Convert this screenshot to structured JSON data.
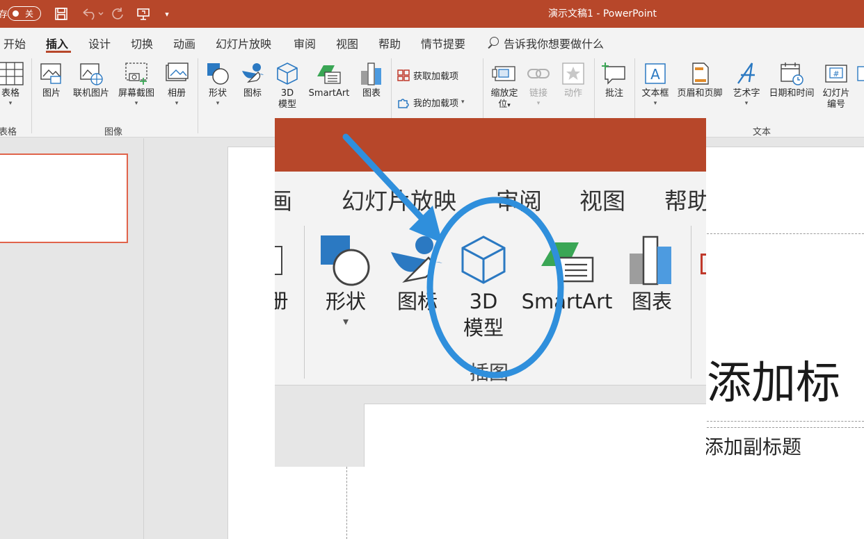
{
  "window": {
    "title": "演示文稿1 - PowerPoint",
    "autosave_partial": "存",
    "autosave_state": "关"
  },
  "tabs": [
    {
      "label": "开始",
      "active": false
    },
    {
      "label": "插入",
      "active": true
    },
    {
      "label": "设计",
      "active": false
    },
    {
      "label": "切换",
      "active": false
    },
    {
      "label": "动画",
      "active": false
    },
    {
      "label": "幻灯片放映",
      "active": false
    },
    {
      "label": "审阅",
      "active": false
    },
    {
      "label": "视图",
      "active": false
    },
    {
      "label": "帮助",
      "active": false
    },
    {
      "label": "情节提要",
      "active": false
    }
  ],
  "tell_me": "告诉我你想要做什么",
  "ribbon": {
    "table": "表格",
    "picture": "图片",
    "online_picture": "联机图片",
    "screenshot": "屏幕截图",
    "album": "相册",
    "shapes": "形状",
    "icons": "图标",
    "model_3d_line1": "3D",
    "model_3d_line2": "模型",
    "smartart": "SmartArt",
    "chart": "图表",
    "get_addins": "获取加载项",
    "my_addins": "我的加载项",
    "zoom_line1": "缩放定",
    "zoom_line2": "位",
    "link": "链接",
    "action": "动作",
    "comment": "批注",
    "textbox": "文本框",
    "header_footer": "页眉和页脚",
    "wordart": "艺术字",
    "datetime": "日期和时间",
    "slide_number_line1": "幻灯片",
    "slide_number_line2": "编号",
    "groups": {
      "tables": "表格",
      "images": "图像",
      "text": "文本"
    }
  },
  "slide": {
    "title_placeholder": "添加标",
    "subtitle_placeholder": "添加副标题"
  },
  "inset": {
    "tabs": [
      "画",
      "幻灯片放映",
      "审阅",
      "视图",
      "帮助"
    ],
    "album_partial": "册",
    "shapes": "形状",
    "icons": "图标",
    "model_3d_line1": "3D",
    "model_3d_line2": "模型",
    "smartart": "SmartArt",
    "chart": "图表",
    "group_partial": "插图"
  },
  "colors": {
    "accent": "#b7472a",
    "annotation": "#2f8fdc",
    "icon_blue": "#2b79c2",
    "icon_green": "#3aa655"
  }
}
